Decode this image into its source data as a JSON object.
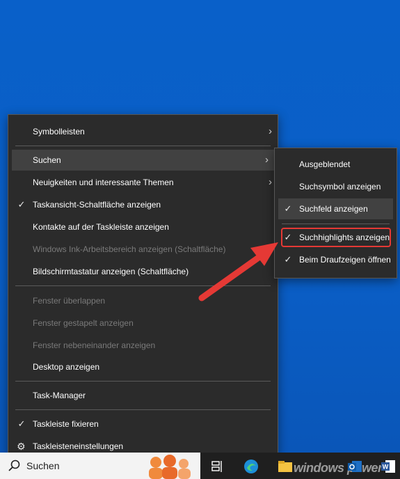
{
  "main_menu": {
    "items": [
      {
        "label": "Symbolleisten",
        "submenu": true
      },
      {
        "label": "Suchen",
        "submenu": true,
        "active": true
      },
      {
        "label": "Neuigkeiten und interessante Themen",
        "submenu": true
      },
      {
        "label": "Taskansicht-Schaltfläche anzeigen",
        "checked": true
      },
      {
        "label": "Kontakte auf der Taskleiste anzeigen"
      },
      {
        "label": "Windows Ink-Arbeitsbereich anzeigen (Schaltfläche)",
        "disabled": true
      },
      {
        "label": "Bildschirmtastatur anzeigen (Schaltfläche)"
      },
      {
        "label": "Fenster überlappen",
        "disabled": true
      },
      {
        "label": "Fenster gestapelt anzeigen",
        "disabled": true
      },
      {
        "label": "Fenster nebeneinander anzeigen",
        "disabled": true
      },
      {
        "label": "Desktop anzeigen"
      },
      {
        "label": "Task-Manager"
      },
      {
        "label": "Taskleiste fixieren",
        "checked": true
      },
      {
        "label": "Taskleisteneinstellungen",
        "icon": "gear-icon"
      }
    ]
  },
  "sub_menu": {
    "items": [
      {
        "label": "Ausgeblendet"
      },
      {
        "label": "Suchsymbol anzeigen"
      },
      {
        "label": "Suchfeld anzeigen",
        "checked": true,
        "active": true
      },
      {
        "label": "Suchhighlights anzeigen",
        "checked": true,
        "highlighted": true
      },
      {
        "label": "Beim Draufzeigen öffnen",
        "checked": true
      }
    ]
  },
  "symbols": {
    "check": "✓",
    "arrow": "›",
    "gear": "⚙"
  },
  "taskbar": {
    "search_placeholder": "Suchen",
    "icons": [
      "search-icon",
      "people-illustration",
      "task-view-icon",
      "edge-icon",
      "file-explorer-icon",
      "outlook-icon",
      "word-icon"
    ],
    "watermark": "windows power"
  },
  "colors": {
    "accent_red": "#e53935",
    "menu_bg": "#2b2b2b",
    "desktop": "#0a5cc7"
  }
}
